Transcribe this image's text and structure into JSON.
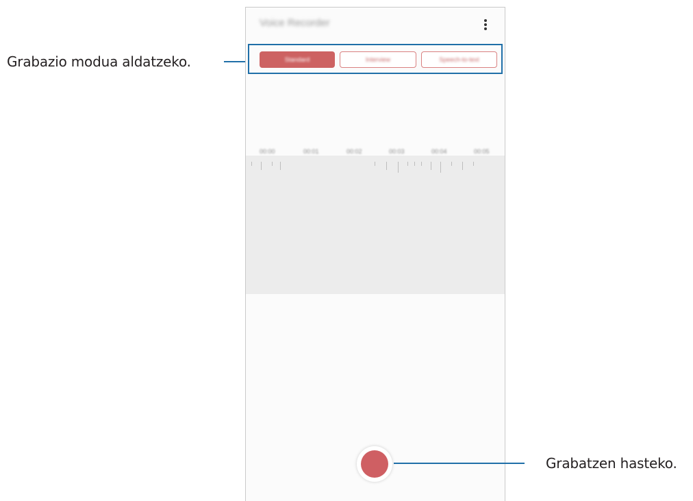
{
  "app": {
    "title": "Voice Recorder",
    "more_icon": "more-vert-icon"
  },
  "modes": [
    {
      "label": "Standard",
      "selected": true
    },
    {
      "label": "Interview",
      "selected": false
    },
    {
      "label": "Speech-to-text",
      "selected": false
    }
  ],
  "timeline": {
    "labels": [
      "00:00",
      "00:01",
      "00:02",
      "00:03",
      "00:04",
      "00:05"
    ]
  },
  "record": {
    "icon": "record-icon"
  },
  "callouts": {
    "mode": "Grabazio modua aldatzeko.",
    "record": "Grabatzen hasteko."
  },
  "colors": {
    "accent": "#cf5f63",
    "callout_line": "#1f6fa8"
  }
}
